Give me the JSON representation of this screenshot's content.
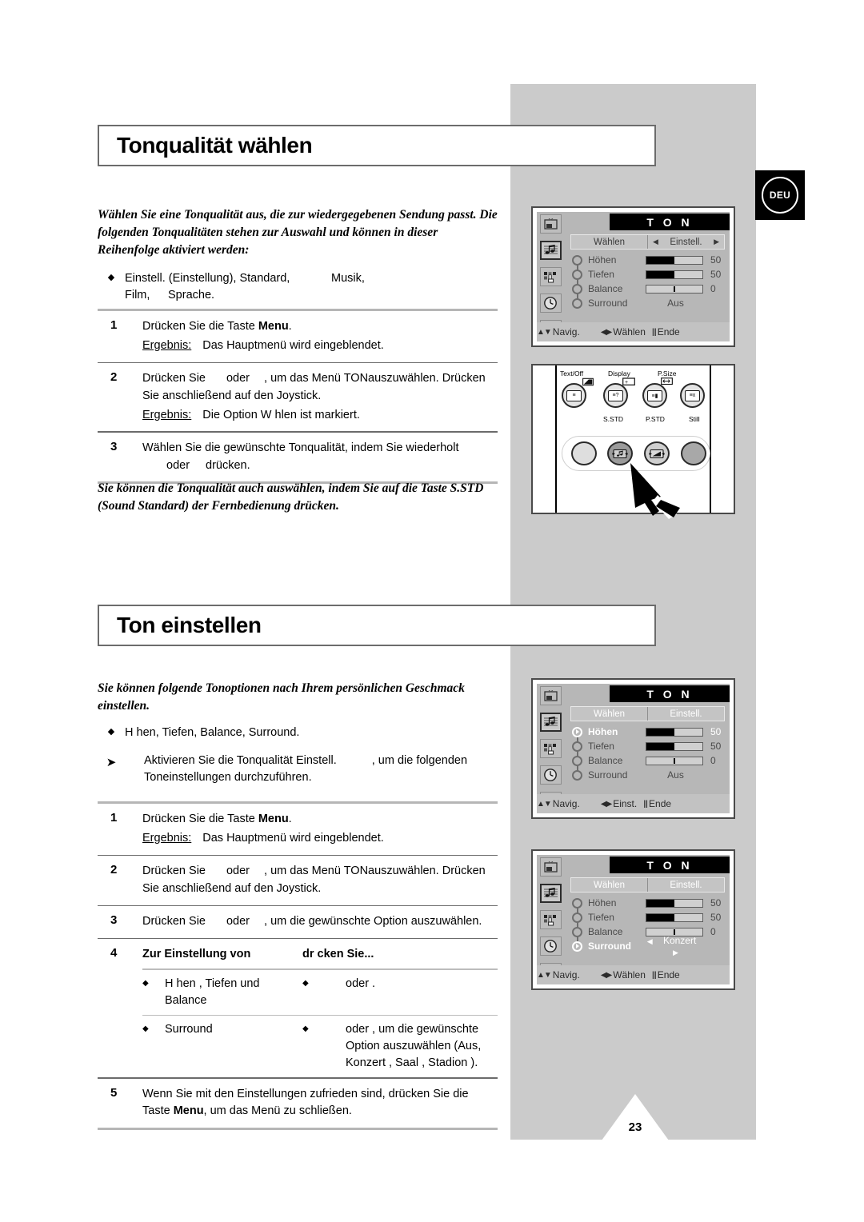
{
  "badge": {
    "label": "DEU"
  },
  "page_number": "23",
  "section1": {
    "title": "Tonqualität wählen",
    "lead": "Wählen Sie eine Tonqualität aus, die zur wiedergegebenen Sendung passt. Die folgenden Tonqualitäten stehen zur Auswahl und können in dieser Reihenfolge aktiviert werden:",
    "bullet": {
      "marker": "◆",
      "line1_a": "Einstell. (Einstellung), Standard,",
      "line1_b": "Musik,",
      "line2_a": "Film,",
      "line2_b": "Sprache."
    },
    "steps": [
      {
        "num": "1",
        "line1_a": "Drücken Sie die Taste ",
        "line1_b": "Menu",
        "line1_c": ".",
        "result_label": "Ergebnis:",
        "result_text": "Das Hauptmenü wird eingeblendet."
      },
      {
        "num": "2",
        "line1_a": "Drücken Sie",
        "line1_b": "oder",
        "line1_c": ", um das Menü TONauszuwählen. Drücken Sie anschließend auf den Joystick.",
        "result_label": "Ergebnis:",
        "result_text": "Die Option W hlen  ist markiert."
      },
      {
        "num": "3",
        "line1_a": "Wählen Sie die gewünschte Tonqualität, indem Sie wiederholt",
        "line1_b": "oder",
        "line1_c": "drücken."
      }
    ],
    "note": "Sie können die Tonqualität auch auswählen, indem Sie auf die Taste S.STD (Sound Standard) der Fernbedienung drücken."
  },
  "section2": {
    "title": "Ton einstellen",
    "lead": "Sie können folgende Tonoptionen nach Ihrem persönlichen Geschmack einstellen.",
    "bullet": {
      "marker": "◆",
      "text": "H hen, Tiefen, Balance, Surround."
    },
    "arrow_note": {
      "marker": "➤",
      "text_a": "Aktivieren Sie die Tonqualität Einstell.",
      "text_b": ", um die folgenden Toneinstellungen durchzuführen."
    },
    "steps": [
      {
        "num": "1",
        "line1_a": "Drücken Sie die Taste ",
        "line1_b": "Menu",
        "line1_c": ".",
        "result_label": "Ergebnis:",
        "result_text": "Das Hauptmenü wird eingeblendet."
      },
      {
        "num": "2",
        "line1_a": "Drücken Sie",
        "line1_b": "oder",
        "line1_c": ", um das Menü TONauszuwählen. Drücken Sie anschließend auf den Joystick."
      },
      {
        "num": "3",
        "line1_a": "Drücken Sie",
        "line1_b": "oder",
        "line1_c": ", um die gewünschte Option auszuwählen."
      }
    ],
    "step4": {
      "num": "4",
      "head_col1": "Zur Einstellung von",
      "head_col2": "dr  cken Sie...",
      "rows": [
        {
          "marker": "◆",
          "col1": "H hen , Tiefen und Balance",
          "col2": "oder   ."
        },
        {
          "marker": "◆",
          "col1": "Surround",
          "col2": "oder   , um die gewünschte Option auszuwählen (Aus, Konzert  , Saal , Stadion  )."
        }
      ]
    },
    "step5": {
      "num": "5",
      "line_a": "Wenn Sie mit den Einstellungen zufrieden sind, drücken Sie die Taste ",
      "line_b": "Menu",
      "line_c": ", um das Menü zu schließen."
    }
  },
  "osd_icons": [
    "tv-picture-icon",
    "music-note-icon",
    "feature-hand-icon",
    "clock-icon",
    "tv-setup-icon"
  ],
  "osd1": {
    "title": "T O N",
    "tab_left": "Wählen",
    "tab_right": "Einstell.",
    "tab_right_arrow_left": "◀",
    "tab_right_arrow_right": "▶",
    "rows": [
      {
        "label": "Höhen",
        "value": "50",
        "fill": 50
      },
      {
        "label": "Tiefen",
        "value": "50",
        "fill": 50
      },
      {
        "label": "Balance",
        "value": "0",
        "fill": 0
      },
      {
        "label": "Surround",
        "value": "Aus"
      }
    ],
    "footer": {
      "nav": "Navig.",
      "select": "Wählen",
      "exit": "Ende"
    }
  },
  "osd2": {
    "title": "T O N",
    "tab_left": "Wählen",
    "tab_right": "Einstell.",
    "rows": [
      {
        "label": "Höhen",
        "value": "50",
        "fill": 50,
        "active": true
      },
      {
        "label": "Tiefen",
        "value": "50",
        "fill": 50
      },
      {
        "label": "Balance",
        "value": "0",
        "fill": 0
      },
      {
        "label": "Surround",
        "value": "Aus"
      }
    ],
    "footer": {
      "nav": "Navig.",
      "select": "Einst.",
      "exit": "Ende"
    }
  },
  "osd3": {
    "title": "T O N",
    "tab_left": "Wählen",
    "tab_right": "Einstell.",
    "rows": [
      {
        "label": "Höhen",
        "value": "50",
        "fill": 50
      },
      {
        "label": "Tiefen",
        "value": "50",
        "fill": 50
      },
      {
        "label": "Balance",
        "value": "0",
        "fill": 0
      },
      {
        "label": "Surround",
        "value": "Konzert",
        "arrow_left": "◀",
        "arrow_right": "▶",
        "active": true
      }
    ],
    "footer": {
      "nav": "Navig.",
      "select": "Wählen",
      "exit": "Ende"
    }
  },
  "remote": {
    "top_labels": [
      "Text/Off",
      "Display",
      "P.Size"
    ],
    "bottom_labels": [
      "S.STD",
      "P.STD",
      "Still"
    ]
  }
}
